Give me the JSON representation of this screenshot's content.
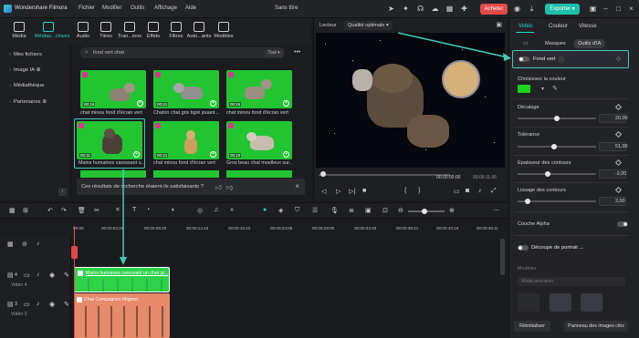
{
  "app": {
    "name": "Wondershare Filmora",
    "doc_title": "Sans titre"
  },
  "menu": [
    "Fichier",
    "Modifier",
    "Outils",
    "Affichage",
    "Aide"
  ],
  "titlebar": {
    "buy": "Acheter",
    "export": "Exporter"
  },
  "tools": [
    "Média",
    "Médias...chives",
    "Audio",
    "Titres",
    "Tran...ions",
    "Effets",
    "Filtres",
    "Auto...ants",
    "Modèles"
  ],
  "sidebar": [
    "Mes fichiers",
    "Image IA",
    "Médiathèque",
    "Partenaires"
  ],
  "search": {
    "value": "fond vert chat",
    "sort": "Tout"
  },
  "thumbs": [
    {
      "caption": "chat minou fond d'écran vert",
      "dur": "00:15"
    },
    {
      "caption": "Chaton chat gris tigré jouant...",
      "dur": "00:21"
    },
    {
      "caption": "chat minou fond d'écran vert",
      "dur": "00:26"
    },
    {
      "caption": "Mains humaines caressant u...",
      "dur": "00:11"
    },
    {
      "caption": "chat minou fond d'écran vert",
      "dur": "00:21"
    },
    {
      "caption": "Gros beau chat moelleux sur...",
      "dur": "00:19"
    }
  ],
  "survey": {
    "question": "Ces résultats de recherche étaient-ils satisfaisants ?"
  },
  "player": {
    "label": "Lecteur",
    "quality": "Qualité optimale",
    "time_current": "00:00:00:00",
    "time_total": "00:00:11:06"
  },
  "right": {
    "tabs": [
      "Vidéo",
      "Couleur",
      "Vitesse"
    ],
    "subtabs": [
      "Masques",
      "Outils d'IA"
    ],
    "fond_vert": "Fond vert",
    "choose_color": "Choisissez la couleur",
    "key_color": "#1ad41a",
    "params": [
      {
        "label": "Décalage",
        "value": "20,00",
        "pos": 0.5
      },
      {
        "label": "Tolérance",
        "value": "51,00",
        "pos": 0.46
      },
      {
        "label": "Épaisseur des contours",
        "value": "-2,00",
        "pos": 0.35
      },
      {
        "label": "Lissage des contours",
        "value": "2,00",
        "pos": 0.12
      }
    ],
    "alpha": "Couche Alpha",
    "portrait": "Découpe de portrait ...",
    "modeles": "Modèles",
    "mode": "Mode précision",
    "reset": "Réinitialiser",
    "ai_panel": "Panneau des images clés"
  },
  "ruler": [
    "00:00",
    "00:00:04:25",
    "00:00:09:20",
    "00:00:14:15",
    "00:00:19:10",
    "00:00:24:05",
    "00:00:29:00",
    "00:00:33:25",
    "00:00:38:21",
    "00:00:43:16",
    "00:00:48:11"
  ],
  "tracks": [
    {
      "num": "4",
      "name": "Vidéo 4"
    },
    {
      "num": "3",
      "name": "Vidéo 3"
    }
  ],
  "clips": {
    "top": "Mains humaines caressant un chat gr...",
    "bottom": "Chat Compagnon Mignon"
  },
  "colors": {
    "accent": "#2ed3c0",
    "green_screen": "#22c432",
    "buy": "#e24a4a",
    "clip_orange": "#e58a6a"
  }
}
